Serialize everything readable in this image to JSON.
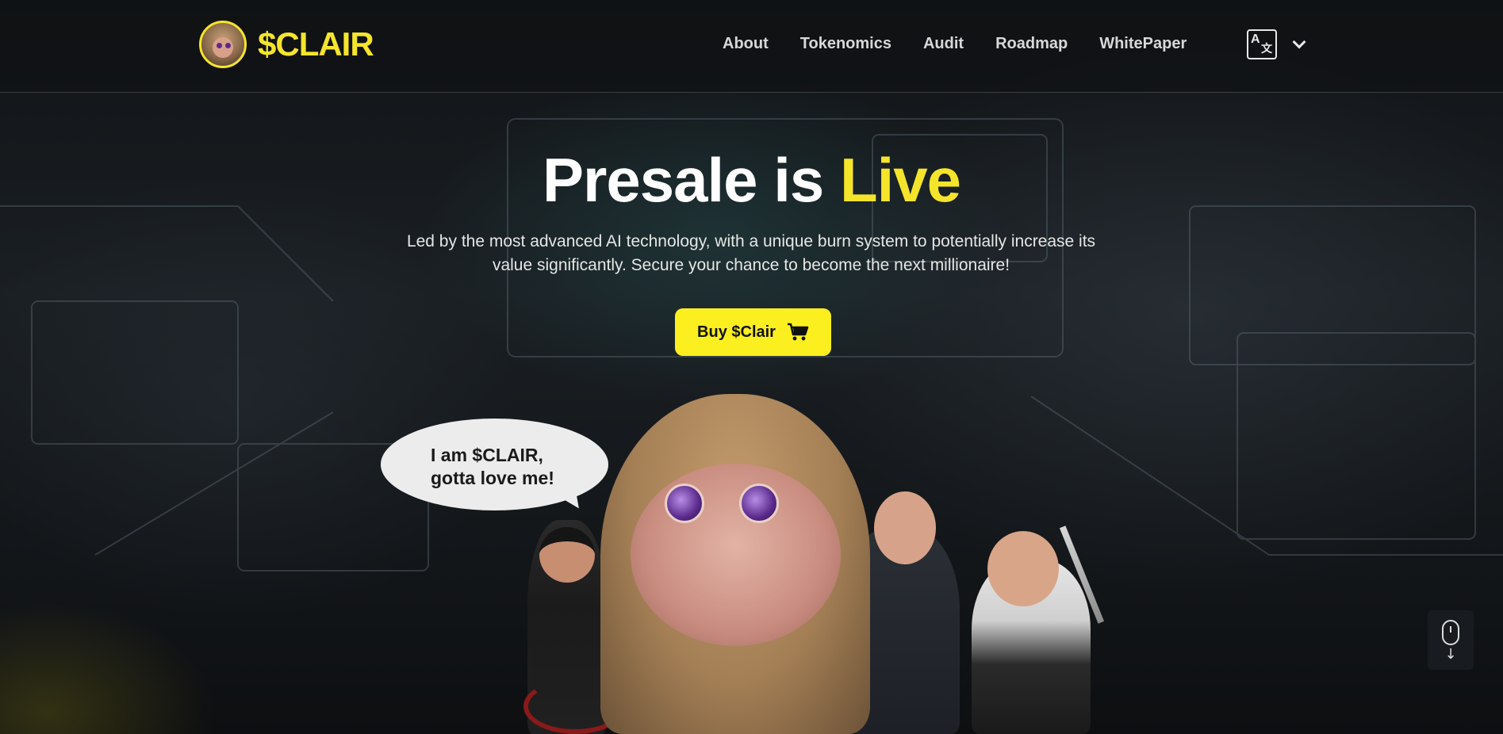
{
  "header": {
    "logo_text": "$CLAIR",
    "nav": [
      "About",
      "Tokenomics",
      "Audit",
      "Roadmap",
      "WhitePaper"
    ],
    "language_icon": "translate-icon",
    "dropdown_icon": "chevron-down-icon"
  },
  "hero": {
    "title_prefix": "Presale is",
    "title_highlight": "Live",
    "subtitle": "Led by the most advanced AI technology, with a unique burn system to potentially increase its value significantly. Secure your chance to become the next millionaire!",
    "buy_button": "Buy $Clair",
    "buy_icon": "cart-icon"
  },
  "bubble": {
    "line1": "I am $CLAIR,",
    "line2": "gotta love me!"
  },
  "scroll_indicator": {
    "icon": "mouse-scroll-icon",
    "arrow": "↓"
  },
  "colors": {
    "accent": "#fbef1f",
    "background": "#0e1114"
  }
}
